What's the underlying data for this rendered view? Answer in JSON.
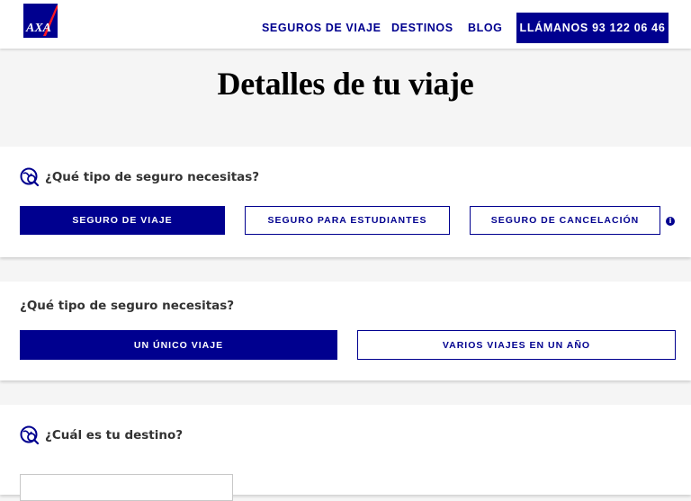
{
  "header": {
    "logo_text": "AXA",
    "nav": {
      "seguros": "SEGUROS DE VIAJE",
      "destinos": "DESTINOS",
      "blog": "BLOG"
    },
    "call_button": "LLÁMANOS 93 122 06 46"
  },
  "page_title": "Detalles de tu viaje",
  "section_insurance": {
    "question": "¿Qué tipo de seguro necesitas?",
    "icon": "globe-search-icon",
    "options": [
      {
        "label": "SEGURO DE VIAJE",
        "selected": true
      },
      {
        "label": "SEGURO PARA ESTUDIANTES",
        "selected": false
      },
      {
        "label": "SEGURO DE CANCELACIÓN",
        "selected": false
      }
    ],
    "info_icon": "i"
  },
  "section_trip": {
    "question": "¿Qué tipo de seguro necesitas?",
    "options": [
      {
        "label": "UN ÚNICO VIAJE",
        "selected": true
      },
      {
        "label": "VARIOS VIAJES EN UN AÑO",
        "selected": false
      }
    ]
  },
  "section_destination": {
    "question": "¿Cuál es tu destino?",
    "icon": "globe-search-icon"
  },
  "colors": {
    "brand": "#00008f",
    "accent_red": "#ff1721",
    "background": "#f5f5f5"
  }
}
